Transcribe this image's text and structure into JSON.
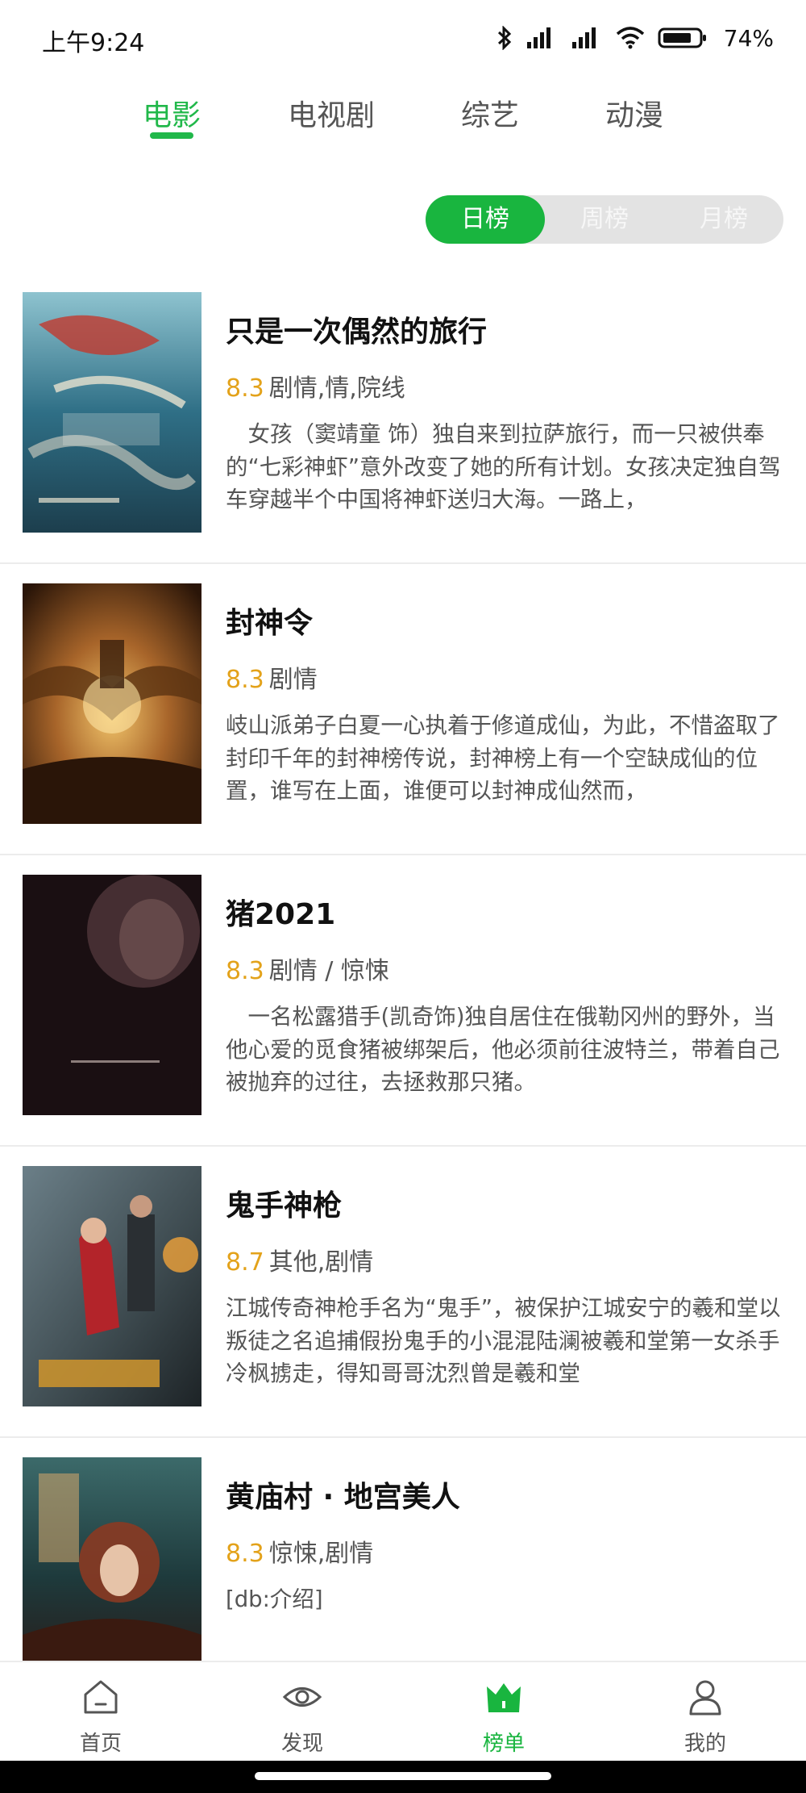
{
  "status_bar": {
    "time": "上午9:24",
    "battery": "74%"
  },
  "top_tabs": [
    {
      "label": "电影",
      "active": true
    },
    {
      "label": "电视剧",
      "active": false
    },
    {
      "label": "综艺",
      "active": false
    },
    {
      "label": "动漫",
      "active": false
    }
  ],
  "ranking_period": {
    "daily": "日榜",
    "weekly": "周榜",
    "monthly": "月榜",
    "selected": "日榜"
  },
  "movies": [
    {
      "title": "只是一次偶然的旅行",
      "rating": "8.3",
      "genres": "剧情,情,院线",
      "description": "　女孩（窦靖童 饰）独自来到拉萨旅行，而一只被供奉的“七彩神虾”意外改变了她的所有计划。女孩决定独自驾车穿越半个中国将神虾送归大海。一路上，",
      "poster_colors": [
        "#2f6f86",
        "#8ec3cf"
      ]
    },
    {
      "title": "封神令",
      "rating": "8.3",
      "genres": "剧情",
      "description": "岐山派弟子白夏一心执着于修道成仙，为此，不惜盗取了封印千年的封神榜传说，封神榜上有一个空缺成仙的位置，谁写在上面，谁便可以封神成仙然而，",
      "poster_colors": [
        "#5a3418",
        "#d8a04a"
      ]
    },
    {
      "title": "猪2021",
      "rating": "8.3",
      "genres": "剧情 / 惊悚",
      "description": "　一名松露猎手(凯奇饰)独自居住在俄勒冈州的野外，当他心爱的觅食猪被绑架后，他必须前往波特兰，带着自己被抛弃的过往，去拯救那只猪。",
      "poster_colors": [
        "#1a0f12",
        "#3a262a"
      ]
    },
    {
      "title": "鬼手神枪",
      "rating": "8.7",
      "genres": "其他,剧情",
      "description": "江城传奇神枪手名为“鬼手”，被保护江城安宁的羲和堂以叛徒之名追捕假扮鬼手的小混混陆澜被羲和堂第一女杀手冷枫掳走，得知哥哥沈烈曾是羲和堂",
      "poster_colors": [
        "#3d4a4f",
        "#b88a3c"
      ]
    },
    {
      "title": "黄庙村 · 地宫美人",
      "rating": "8.3",
      "genres": "惊悚,剧情",
      "description": "[db:介绍]",
      "poster_colors": [
        "#1e3a3c",
        "#8a3a22"
      ]
    }
  ],
  "bottom_nav": [
    {
      "label": "首页",
      "icon": "home-icon",
      "active": false
    },
    {
      "label": "发现",
      "icon": "eye-icon",
      "active": false
    },
    {
      "label": "榜单",
      "icon": "crown-icon",
      "active": true
    },
    {
      "label": "我的",
      "icon": "user-icon",
      "active": false
    }
  ],
  "colors": {
    "accent": "#19b53f",
    "rating": "#e3a21a",
    "text_secondary": "#555555"
  }
}
